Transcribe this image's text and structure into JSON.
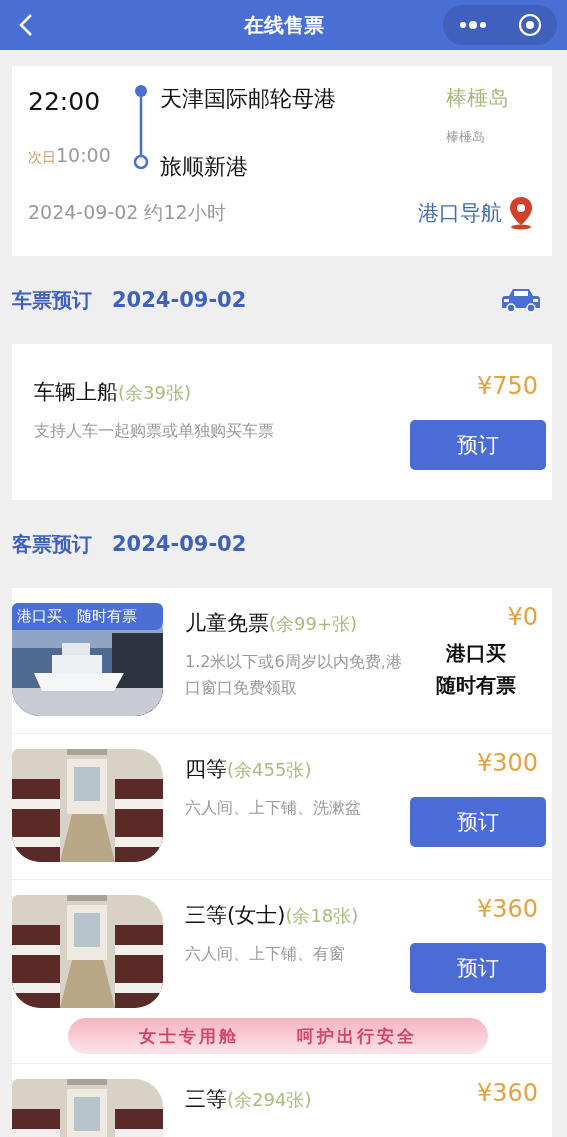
{
  "header": {
    "title": "在线售票"
  },
  "trip": {
    "depart_time": "22:00",
    "arrive_day": "次日",
    "arrive_time": "10:00",
    "from_port": "天津国际邮轮母港",
    "to_port": "旅顺新港",
    "ship_name": "棒棰岛",
    "ship_subtitle": "棒棰岛",
    "date_duration": "2024-09-02 约12小时",
    "navigation": "港口导航"
  },
  "vehicle_section": {
    "title": "车票预订",
    "date": "2024-09-02"
  },
  "vehicle_ticket": {
    "name": "车辆上船",
    "remaining": "(余39张)",
    "note": "支持人车一起购票或单独购买车票",
    "price": "¥750",
    "button": "预订"
  },
  "passenger_section": {
    "title": "客票预订",
    "date": "2024-09-02"
  },
  "tickets": [
    {
      "kind": "port",
      "badge": "港口买、随时有票",
      "name": "儿童免票",
      "remaining": "(余99+张)",
      "note": "1.2米以下或6周岁以内免费,港口窗口免费领取",
      "price": "¥0",
      "port_note": [
        "港口买",
        "随时有票"
      ]
    },
    {
      "kind": "book",
      "name": "四等",
      "remaining": "(余455张)",
      "note": "六人间、上下铺、洗漱盆",
      "price": "¥300",
      "button": "预订"
    },
    {
      "kind": "book",
      "name": "三等(女士)",
      "remaining": "(余18张)",
      "note": "六人间、上下铺、有窗",
      "price": "¥360",
      "button": "预订",
      "banner": [
        "女士专用舱",
        "呵护出行安全"
      ]
    },
    {
      "kind": "cut",
      "name": "三等",
      "remaining": "(余294张)",
      "price": "¥360"
    }
  ]
}
